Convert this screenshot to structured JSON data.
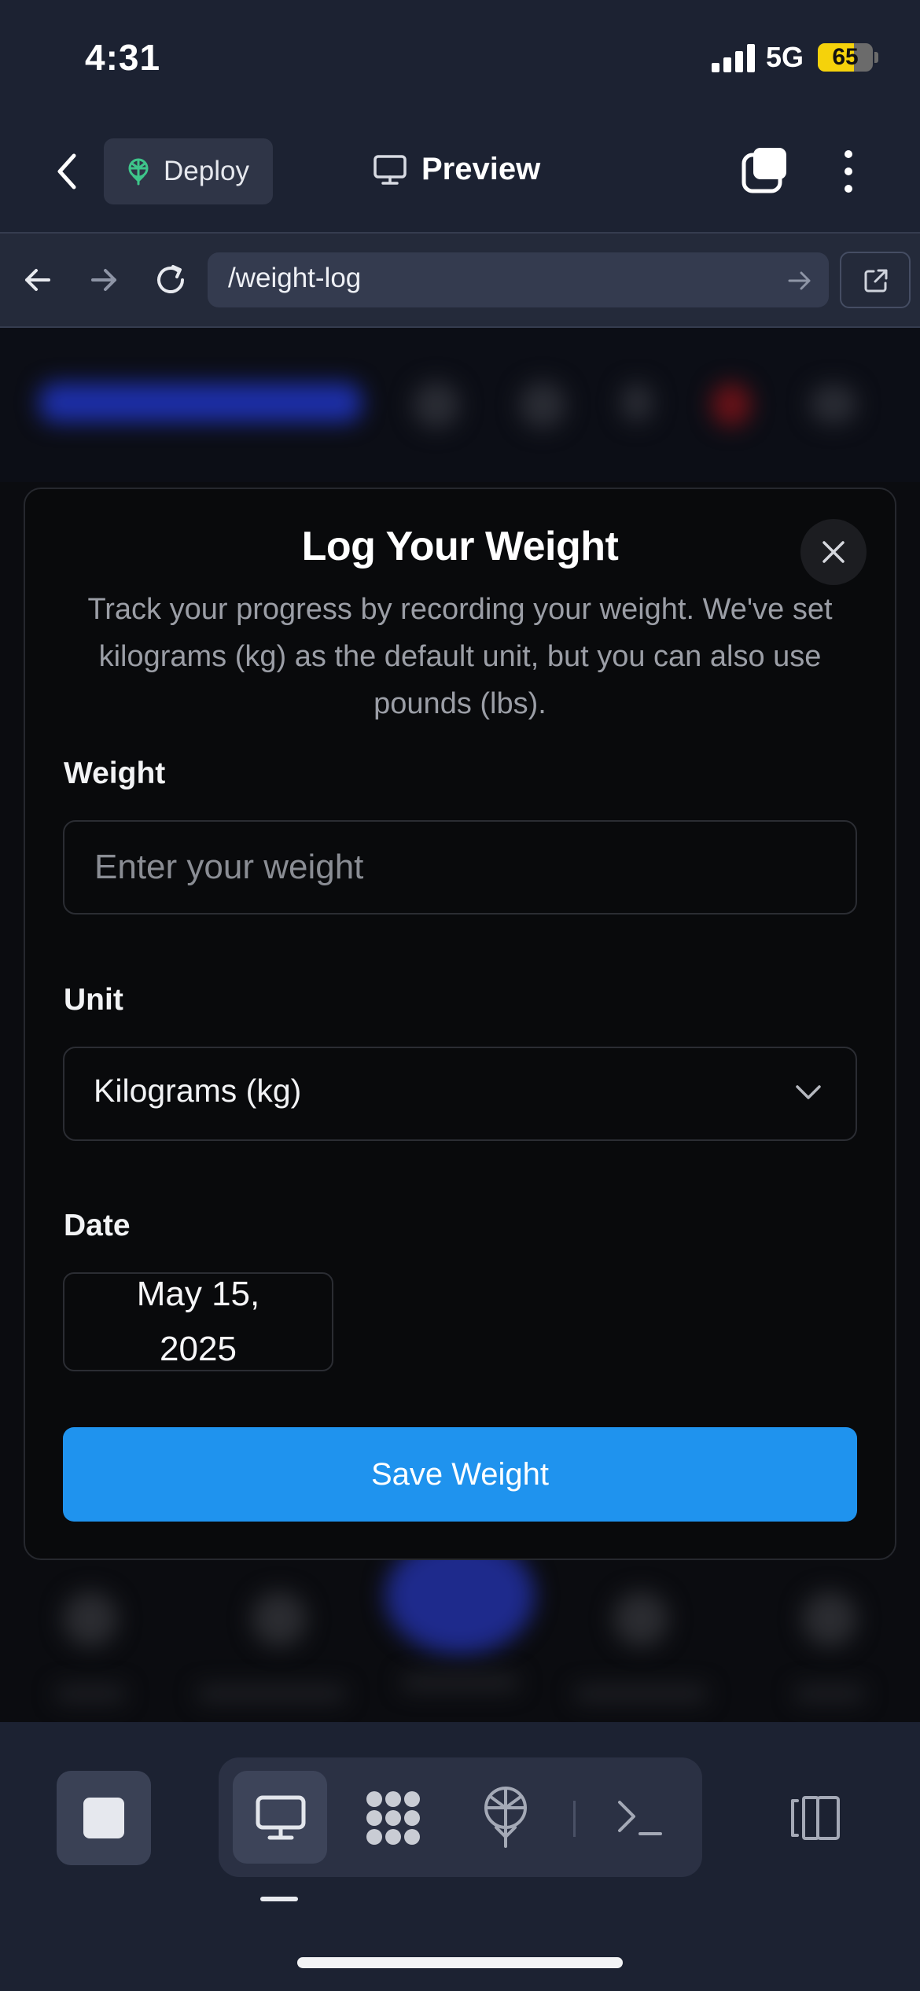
{
  "status_bar": {
    "time": "4:31",
    "network": "5G",
    "battery": "65",
    "battery_level": 0.65
  },
  "top_bar": {
    "deploy_label": "Deploy",
    "preview_label": "Preview"
  },
  "url_bar": {
    "url": "/weight-log"
  },
  "modal": {
    "title": "Log Your Weight",
    "description": "Track your progress by recording your weight. We've set kilograms (kg) as the default unit, but you can also use pounds (lbs).",
    "weight_label": "Weight",
    "weight_placeholder": "Enter your weight",
    "unit_label": "Unit",
    "unit_value": "Kilograms (kg)",
    "date_label": "Date",
    "date_value": "May 15, 2025",
    "save_label": "Save Weight"
  },
  "colors": {
    "primary": "#1f93ee",
    "background": "#1c2232",
    "modal_bg": "#090a0c",
    "deploy_icon": "#3ec58a"
  },
  "icons": [
    "back-icon",
    "deploy-icon",
    "monitor-icon",
    "tabs-icon",
    "more-icon",
    "arrow-left-icon",
    "arrow-right-icon",
    "reload-icon",
    "go-icon",
    "external-link-icon",
    "close-icon",
    "chevron-down-icon",
    "stop-icon",
    "monitor-icon",
    "nodes-icon",
    "deploy-icon",
    "terminal-icon",
    "panel-icon"
  ]
}
